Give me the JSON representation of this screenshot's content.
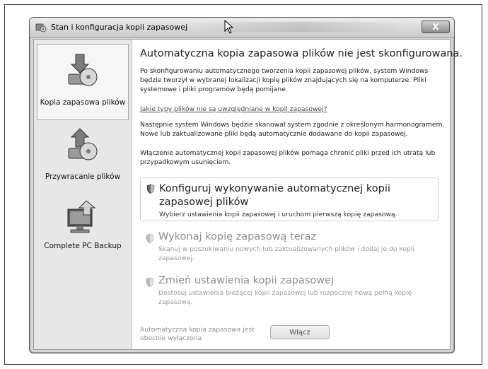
{
  "window": {
    "title": "Stan i konfiguracja kopii zapasowej",
    "close_label": "X"
  },
  "sidebar": {
    "items": [
      {
        "label": "Kopia zapasowa plików",
        "icon": "backup-files-icon",
        "selected": true
      },
      {
        "label": "Przywracanie plików",
        "icon": "restore-files-icon",
        "selected": false
      },
      {
        "label": "Complete PC Backup",
        "icon": "complete-pc-backup-icon",
        "selected": false
      }
    ]
  },
  "main": {
    "heading": "Automatyczna kopia zapasowa plików nie jest skonfigurowana.",
    "intro": "Po skonfigurowaniu automatycznego tworzenia kopii zapasowej plików, system Windows będzie tworzył w wybranej lokalizacji kopię plików znajdujących się na komputerze. Pliki systemowe i pliki programów będą pomijane.",
    "link": "Jakie typy plików nie są uwzględniane w kopii zapasowej?",
    "schedule_text": "Następnie system Windows będzie skanował system zgodnie z określonym harmonogramem. Nowe lub zaktualizowane pliki będą automatycznie dodawane do kopii zapasowej.",
    "protect_text": "Włączenie automatycznej kopii zapasowej plików pomaga chronić pliki przed ich utratą lub przypadkowym usunięciem.",
    "actions": [
      {
        "title": "Konfiguruj wykonywanie automatycznej kopii zapasowej plików",
        "desc": "Wybierz ustawienia kopii zapasowej i uruchom pierwszą kopię zapasową.",
        "enabled": true
      },
      {
        "title": "Wykonaj kopię zapasową teraz",
        "desc": "Skanuj w poszukiwaniu nowych lub zaktualizowanych plików i dodaj je do kopii zapasowej.",
        "enabled": false
      },
      {
        "title": "Zmień ustawienia kopii zapasowej",
        "desc": "Dostosuj ustawienia bieżącej kopii zapasowej lub rozpocznij nową pełną kopię zapasową.",
        "enabled": false
      }
    ],
    "status_text": "Automatyczna kopia zapasowa jest obecnie wyłączona",
    "enable_button": "Włącz"
  },
  "colors": {
    "sidebar_bg": "#e7e7e7",
    "disabled_text": "#8e8e8e"
  }
}
